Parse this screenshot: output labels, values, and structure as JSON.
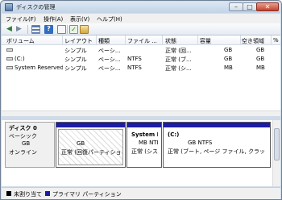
{
  "window": {
    "title": "ディスクの管理",
    "minimize": "–",
    "maximize": "□",
    "close": "✕"
  },
  "menu": [
    "ファイル(F)",
    "操作(A)",
    "表示(V)",
    "ヘルプ(H)"
  ],
  "toolbar": {
    "back": "◀",
    "forward": "▶",
    "help": "?",
    "check": "✓"
  },
  "columns": [
    "ボリューム",
    "レイアウト",
    "種類",
    "ファイル ...",
    "状態",
    "容量",
    "空き領域",
    "%"
  ],
  "volumes": [
    {
      "name": "",
      "layout": "シンプル",
      "type": "ベーシ...",
      "fs": "",
      "status": "正常 (回...",
      "cap_num": "",
      "cap": "GB",
      "free_num": "",
      "free": "GB",
      "pct": ""
    },
    {
      "name": "(C:)",
      "layout": "シンプル",
      "type": "ベーシ...",
      "fs": "NTFS",
      "status": "正常 (ブ...",
      "cap_num": "",
      "cap": "GB",
      "free_num": "",
      "free": "GB",
      "pct": ""
    },
    {
      "name": "System Reserved",
      "layout": "シンプル",
      "type": "ベーシ...",
      "fs": "NTFS",
      "status": "正常 (シ...",
      "cap_num": "",
      "cap": "MB",
      "free_num": "",
      "free": "MB",
      "pct": ""
    }
  ],
  "disk": {
    "name": "ディスク 0",
    "type": "ベーシック",
    "size": "GB",
    "state": "オンライン",
    "partitions": [
      {
        "title": "",
        "size": "GB",
        "status": "正常 (回復パーティション"
      },
      {
        "title": "System Re",
        "size": "MB NTI",
        "status": "正常 (システ"
      },
      {
        "title": "(C:)",
        "size": "GB NTFS",
        "status": "正常 (ブート, ページ ファイル, クラッ"
      }
    ]
  },
  "legend": {
    "unallocated": {
      "label": "未割り当て",
      "color": "#000000"
    },
    "primary": {
      "label": "プライマリ パーティション",
      "color": "#1c1ca6"
    }
  }
}
